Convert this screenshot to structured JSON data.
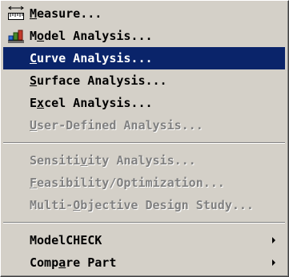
{
  "menu": {
    "items": [
      {
        "label": "Measure...",
        "mnemonic": "M",
        "state": "enabled",
        "icon": "measure-icon"
      },
      {
        "label": "Model Analysis...",
        "mnemonic": "o",
        "state": "enabled",
        "icon": "model-analysis-icon"
      },
      {
        "label": "Curve Analysis...",
        "mnemonic": "C",
        "state": "selected"
      },
      {
        "label": "Surface Analysis...",
        "mnemonic": "S",
        "state": "enabled"
      },
      {
        "label": "Excel Analysis...",
        "mnemonic": "x",
        "state": "enabled"
      },
      {
        "label": "User-Defined Analysis...",
        "mnemonic": "U",
        "state": "disabled"
      },
      {
        "label": "Sensitivity Analysis...",
        "mnemonic": "v",
        "state": "disabled"
      },
      {
        "label": "Feasibility/Optimization...",
        "mnemonic": "F",
        "state": "disabled"
      },
      {
        "label": "Multi-Objective Design Study...",
        "mnemonic": "O",
        "state": "disabled"
      },
      {
        "label": "ModelCHECK",
        "state": "enabled",
        "submenu": true
      },
      {
        "label": "Compare Part",
        "mnemonic": "a",
        "state": "enabled",
        "submenu": true
      }
    ],
    "colors": {
      "menu_background": "#d4d0c8",
      "highlight_background": "#0a246a",
      "highlight_text": "#ffffff",
      "disabled_text": "#808080"
    }
  }
}
